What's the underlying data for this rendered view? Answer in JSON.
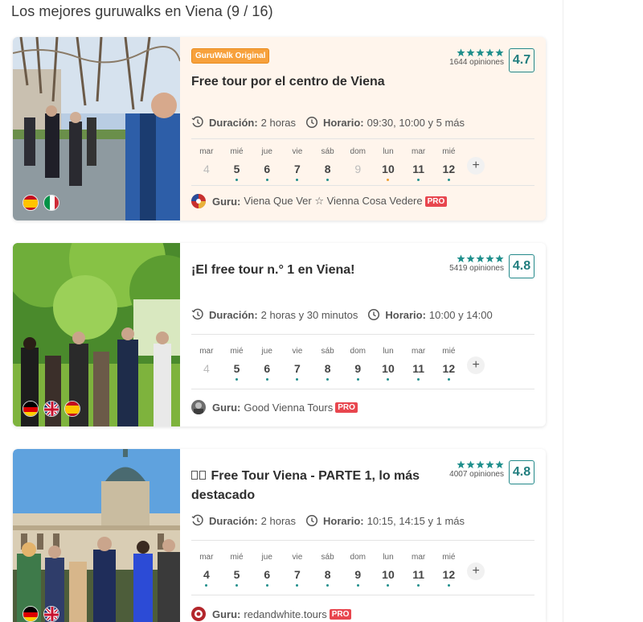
{
  "page": {
    "title": "Los mejores guruwalks en Viena (9 / 16)"
  },
  "labels": {
    "duration": "Duración:",
    "schedule": "Horario:",
    "guru": "Guru:",
    "pro": "PRO",
    "more_dates": "+"
  },
  "colors": {
    "accent": "#1f7d7e",
    "star": "#1f8f8c",
    "pro": "#e8464e",
    "original_badge": "#f7a13c",
    "highlight_bg": "#fff5ec"
  },
  "cards": [
    {
      "badge": "GuruWalk Original",
      "title": "Free tour por el centro de Viena",
      "stars": 5,
      "reviews": "1644 opiniones",
      "score": "4.7",
      "duration": "2 horas",
      "schedule": "09:30, 10:00 y 5 más",
      "flags": [
        "spain-flag",
        "italy-flag"
      ],
      "days": [
        {
          "wd": "mar",
          "dn": "4",
          "available": false,
          "dot": "none"
        },
        {
          "wd": "mié",
          "dn": "5",
          "available": true,
          "dot": "teal"
        },
        {
          "wd": "jue",
          "dn": "6",
          "available": true,
          "dot": "teal"
        },
        {
          "wd": "vie",
          "dn": "7",
          "available": true,
          "dot": "teal"
        },
        {
          "wd": "sáb",
          "dn": "8",
          "available": true,
          "dot": "teal"
        },
        {
          "wd": "dom",
          "dn": "9",
          "available": false,
          "dot": "none"
        },
        {
          "wd": "lun",
          "dn": "10",
          "available": true,
          "dot": "orange"
        },
        {
          "wd": "mar",
          "dn": "11",
          "available": true,
          "dot": "teal"
        },
        {
          "wd": "mié",
          "dn": "12",
          "available": true,
          "dot": "teal"
        }
      ],
      "guru": "Viena Que Ver ☆ Vienna Cosa Vedere"
    },
    {
      "badge": "",
      "title": "¡El free tour n.° 1 en Viena!",
      "stars": 5,
      "reviews": "5419 opiniones",
      "score": "4.8",
      "duration": "2 horas y 30 minutos",
      "schedule": "10:00 y 14:00",
      "flags": [
        "germany-flag",
        "uk-flag",
        "spain-flag"
      ],
      "days": [
        {
          "wd": "mar",
          "dn": "4",
          "available": false,
          "dot": "none"
        },
        {
          "wd": "mié",
          "dn": "5",
          "available": true,
          "dot": "teal"
        },
        {
          "wd": "jue",
          "dn": "6",
          "available": true,
          "dot": "teal"
        },
        {
          "wd": "vie",
          "dn": "7",
          "available": true,
          "dot": "teal"
        },
        {
          "wd": "sáb",
          "dn": "8",
          "available": true,
          "dot": "teal"
        },
        {
          "wd": "dom",
          "dn": "9",
          "available": true,
          "dot": "teal"
        },
        {
          "wd": "lun",
          "dn": "10",
          "available": true,
          "dot": "teal"
        },
        {
          "wd": "mar",
          "dn": "11",
          "available": true,
          "dot": "teal"
        },
        {
          "wd": "mié",
          "dn": "12",
          "available": true,
          "dot": "teal"
        }
      ],
      "guru": "Good Vienna Tours"
    },
    {
      "badge": "",
      "title": "  Free Tour Viena - PARTE 1, lo más destacado",
      "stars": 5,
      "reviews": "4007 opiniones",
      "score": "4.8",
      "duration": "2 horas",
      "schedule": "10:15, 14:15 y 1 más",
      "flags": [
        "germany-flag",
        "uk-flag"
      ],
      "days": [
        {
          "wd": "mar",
          "dn": "4",
          "available": true,
          "dot": "teal"
        },
        {
          "wd": "mié",
          "dn": "5",
          "available": true,
          "dot": "teal"
        },
        {
          "wd": "jue",
          "dn": "6",
          "available": true,
          "dot": "teal"
        },
        {
          "wd": "vie",
          "dn": "7",
          "available": true,
          "dot": "teal"
        },
        {
          "wd": "sáb",
          "dn": "8",
          "available": true,
          "dot": "teal"
        },
        {
          "wd": "dom",
          "dn": "9",
          "available": true,
          "dot": "teal"
        },
        {
          "wd": "lun",
          "dn": "10",
          "available": true,
          "dot": "teal"
        },
        {
          "wd": "mar",
          "dn": "11",
          "available": true,
          "dot": "teal"
        },
        {
          "wd": "mié",
          "dn": "12",
          "available": true,
          "dot": "teal"
        }
      ],
      "guru": "redandwhite.tours"
    }
  ]
}
